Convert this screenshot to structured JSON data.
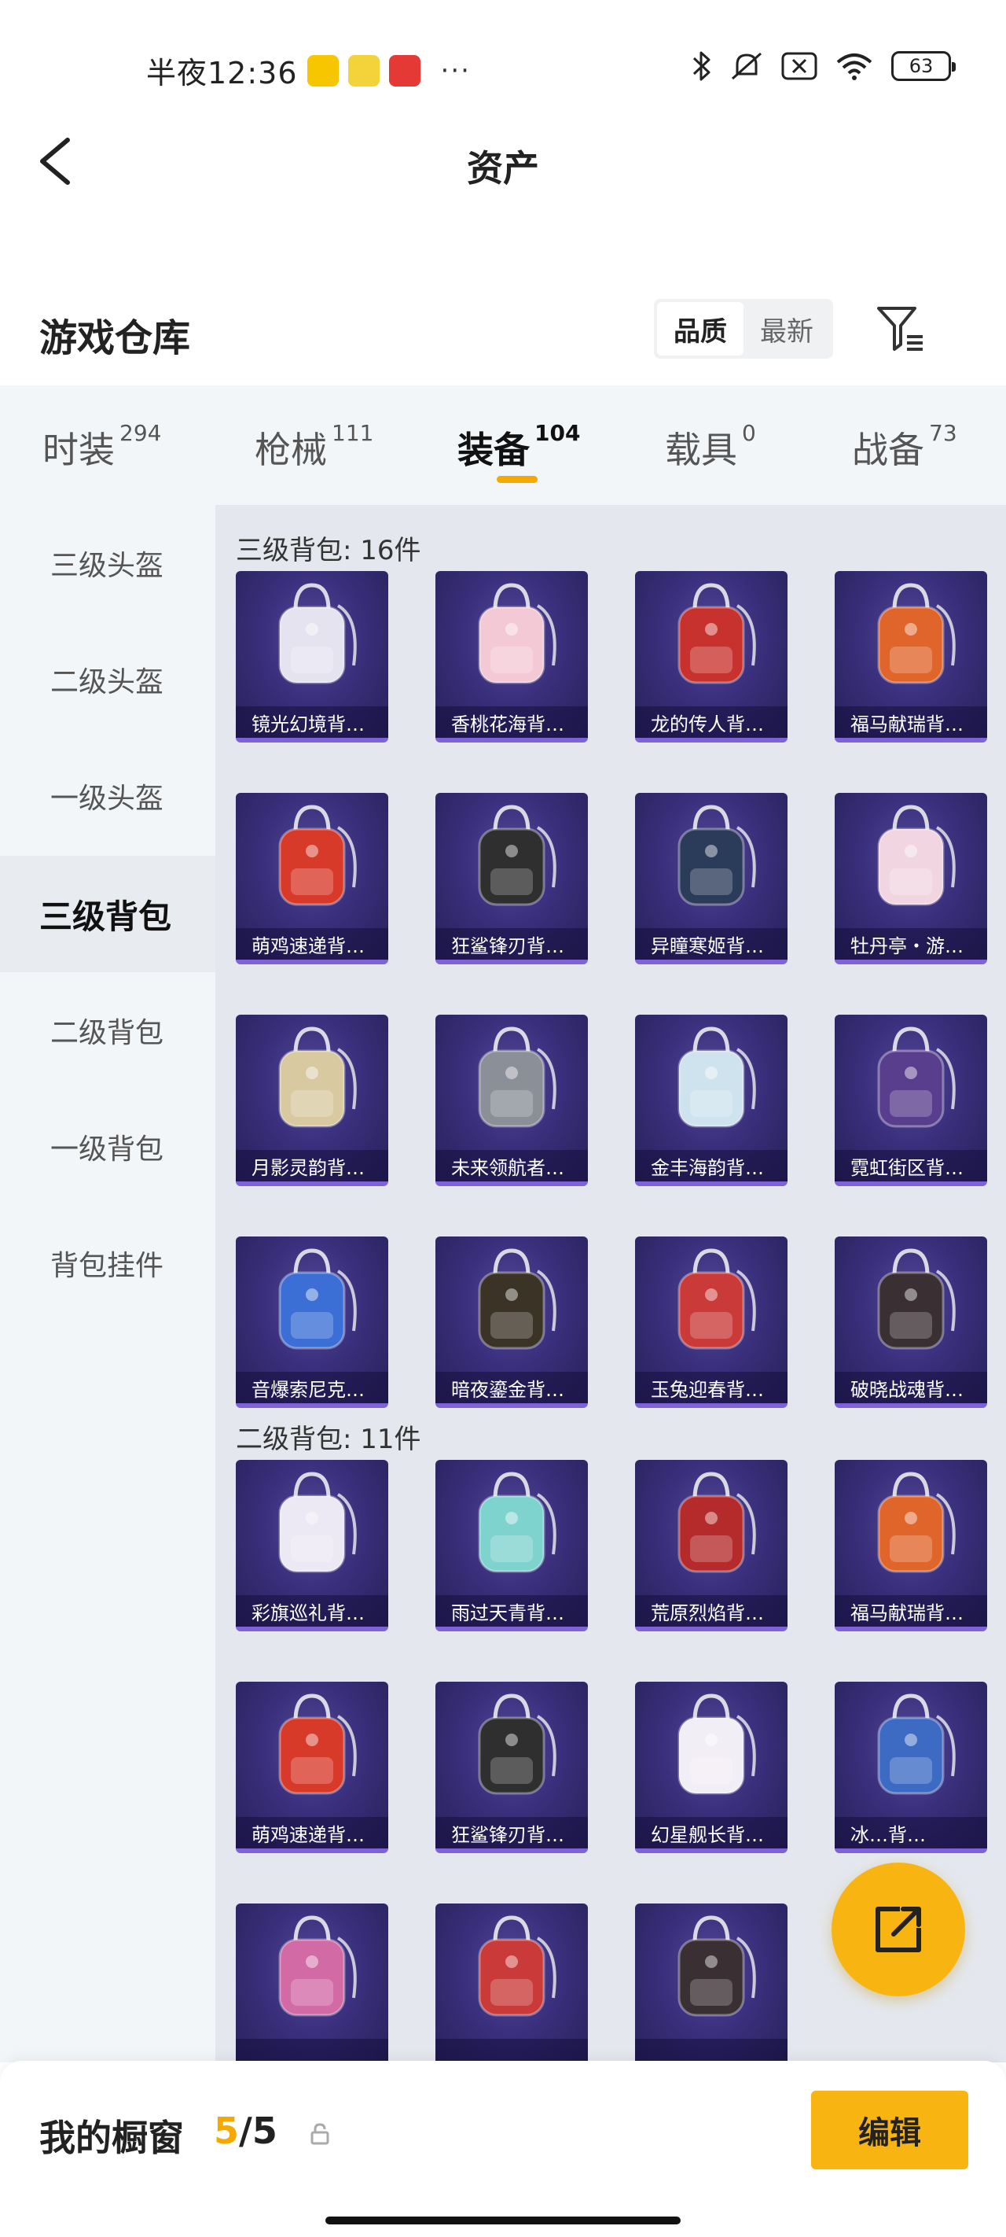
{
  "status_bar": {
    "time": "半夜12:36",
    "dots": "···",
    "battery": "63"
  },
  "header": {
    "title": "资产"
  },
  "warehouse": {
    "title": "游戏仓库",
    "sort_options": [
      "品质",
      "最新"
    ],
    "active_sort": "品质"
  },
  "tabs": [
    {
      "label": "时装",
      "count": "294"
    },
    {
      "label": "枪械",
      "count": "111"
    },
    {
      "label": "装备",
      "count": "104"
    },
    {
      "label": "载具",
      "count": "0"
    },
    {
      "label": "战备",
      "count": "73"
    }
  ],
  "active_tab": "装备",
  "sidebar": [
    {
      "label": "三级头盔"
    },
    {
      "label": "二级头盔"
    },
    {
      "label": "一级头盔"
    },
    {
      "label": "三级背包"
    },
    {
      "label": "二级背包"
    },
    {
      "label": "一级背包"
    },
    {
      "label": "背包挂件"
    }
  ],
  "active_sidebar": "三级背包",
  "groups": [
    {
      "title": "三级背包: 16件",
      "items": [
        {
          "name": "镜光幻境背…",
          "color": "#e6e3f0"
        },
        {
          "name": "香桃花海背…",
          "color": "#f4c9d6"
        },
        {
          "name": "龙的传人背…",
          "color": "#c8322e"
        },
        {
          "name": "福马献瑞背…",
          "color": "#e0652a"
        },
        {
          "name": "萌鸡速递背…",
          "color": "#d83a2a"
        },
        {
          "name": "狂鲨锋刃背…",
          "color": "#2f2f2f"
        },
        {
          "name": "异瞳寒姬背…",
          "color": "#2b3b5a"
        },
        {
          "name": "牡丹亭・游…",
          "color": "#f1d6e2"
        },
        {
          "name": "月影灵韵背…",
          "color": "#d8c9a0"
        },
        {
          "name": "未来领航者…",
          "color": "#8a8f98"
        },
        {
          "name": "金丰海韵背…",
          "color": "#cfe3ee"
        },
        {
          "name": "霓虹街区背…",
          "color": "#5a3e8e"
        },
        {
          "name": "音爆索尼克…",
          "color": "#3c6fd6"
        },
        {
          "name": "暗夜鎏金背…",
          "color": "#3a3326"
        },
        {
          "name": "玉兔迎春背…",
          "color": "#c93a38"
        },
        {
          "name": "破晓战魂背…",
          "color": "#3a2f33"
        }
      ]
    },
    {
      "title": "二级背包: 11件",
      "items": [
        {
          "name": "彩旗巡礼背…",
          "color": "#ece8f4"
        },
        {
          "name": "雨过天青背…",
          "color": "#7fd3cf"
        },
        {
          "name": "荒原烈焰背…",
          "color": "#b52a2a"
        },
        {
          "name": "福马献瑞背…",
          "color": "#e0652a"
        },
        {
          "name": "萌鸡速递背…",
          "color": "#d83a2a"
        },
        {
          "name": "狂鲨锋刃背…",
          "color": "#2f2f2f"
        },
        {
          "name": "幻星舰长背…",
          "color": "#f2eef5"
        },
        {
          "name": "冰…背…",
          "color": "#3d6bc4"
        },
        {
          "name": "",
          "color": "#d26aa6"
        },
        {
          "name": "",
          "color": "#c93a38"
        },
        {
          "name": "",
          "color": "#3a2f33"
        }
      ]
    }
  ],
  "showcase": {
    "label": "我的橱窗",
    "current": "5",
    "sep_total": "/5",
    "edit": "编辑"
  },
  "colors": {
    "accent": "#f8b512",
    "card_bg": "#3a2f7c",
    "card_border": "#7d62d8"
  }
}
